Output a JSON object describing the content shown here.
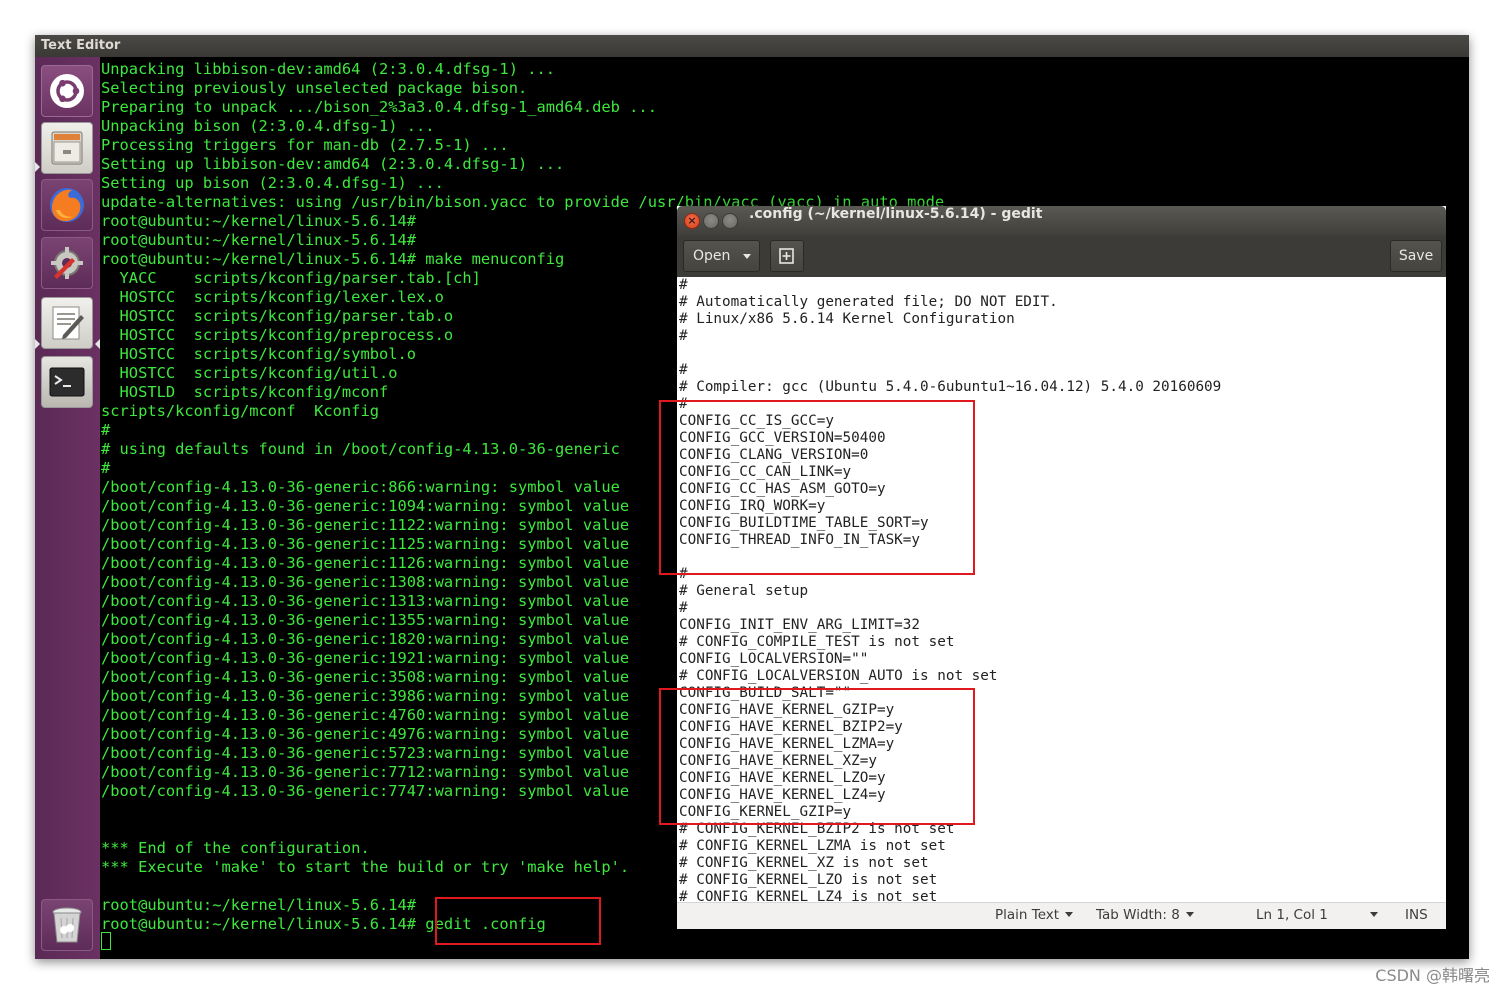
{
  "topbar": {
    "title": "Text Editor"
  },
  "launcher": {
    "items": [
      {
        "name": "ubuntu-dash"
      },
      {
        "name": "files"
      },
      {
        "name": "firefox"
      },
      {
        "name": "system-settings"
      },
      {
        "name": "text-editor"
      },
      {
        "name": "terminal"
      },
      {
        "name": "trash"
      }
    ]
  },
  "terminal": {
    "lines": [
      "Unpacking libbison-dev:amd64 (2:3.0.4.dfsg-1) ...",
      "Selecting previously unselected package bison.",
      "Preparing to unpack .../bison_2%3a3.0.4.dfsg-1_amd64.deb ...",
      "Unpacking bison (2:3.0.4.dfsg-1) ...",
      "Processing triggers for man-db (2.7.5-1) ...",
      "Setting up libbison-dev:amd64 (2:3.0.4.dfsg-1) ...",
      "Setting up bison (2:3.0.4.dfsg-1) ...",
      "update-alternatives: using /usr/bin/bison.yacc to provide /usr/bin/yacc (yacc) in auto mode",
      "root@ubuntu:~/kernel/linux-5.6.14#",
      "root@ubuntu:~/kernel/linux-5.6.14#",
      "root@ubuntu:~/kernel/linux-5.6.14# make menuconfig",
      "  YACC    scripts/kconfig/parser.tab.[ch]",
      "  HOSTCC  scripts/kconfig/lexer.lex.o",
      "  HOSTCC  scripts/kconfig/parser.tab.o",
      "  HOSTCC  scripts/kconfig/preprocess.o",
      "  HOSTCC  scripts/kconfig/symbol.o",
      "  HOSTCC  scripts/kconfig/util.o",
      "  HOSTLD  scripts/kconfig/mconf",
      "scripts/kconfig/mconf  Kconfig",
      "#",
      "# using defaults found in /boot/config-4.13.0-36-generic",
      "#",
      "/boot/config-4.13.0-36-generic:866:warning: symbol value",
      "/boot/config-4.13.0-36-generic:1094:warning: symbol value",
      "/boot/config-4.13.0-36-generic:1122:warning: symbol value",
      "/boot/config-4.13.0-36-generic:1125:warning: symbol value",
      "/boot/config-4.13.0-36-generic:1126:warning: symbol value",
      "/boot/config-4.13.0-36-generic:1308:warning: symbol value",
      "/boot/config-4.13.0-36-generic:1313:warning: symbol value",
      "/boot/config-4.13.0-36-generic:1355:warning: symbol value",
      "/boot/config-4.13.0-36-generic:1820:warning: symbol value",
      "/boot/config-4.13.0-36-generic:1921:warning: symbol value",
      "/boot/config-4.13.0-36-generic:3508:warning: symbol value",
      "/boot/config-4.13.0-36-generic:3986:warning: symbol value",
      "/boot/config-4.13.0-36-generic:4760:warning: symbol value",
      "/boot/config-4.13.0-36-generic:4976:warning: symbol value",
      "/boot/config-4.13.0-36-generic:5723:warning: symbol value",
      "/boot/config-4.13.0-36-generic:7712:warning: symbol value",
      "/boot/config-4.13.0-36-generic:7747:warning: symbol value",
      "",
      "",
      "*** End of the configuration.",
      "*** Execute 'make' to start the build or try 'make help'.",
      "",
      "root@ubuntu:~/kernel/linux-5.6.14#",
      "root@ubuntu:~/kernel/linux-5.6.14# gedit .config"
    ]
  },
  "gedit": {
    "title": ".config (~/kernel/linux-5.6.14) - gedit",
    "open_label": "Open",
    "save_label": "Save",
    "lines": [
      "#",
      "# Automatically generated file; DO NOT EDIT.",
      "# Linux/x86 5.6.14 Kernel Configuration",
      "#",
      "",
      "#",
      "# Compiler: gcc (Ubuntu 5.4.0-6ubuntu1~16.04.12) 5.4.0 20160609",
      "#",
      "CONFIG_CC_IS_GCC=y",
      "CONFIG_GCC_VERSION=50400",
      "CONFIG_CLANG_VERSION=0",
      "CONFIG_CC_CAN_LINK=y",
      "CONFIG_CC_HAS_ASM_GOTO=y",
      "CONFIG_IRQ_WORK=y",
      "CONFIG_BUILDTIME_TABLE_SORT=y",
      "CONFIG_THREAD_INFO_IN_TASK=y",
      "",
      "#",
      "# General setup",
      "#",
      "CONFIG_INIT_ENV_ARG_LIMIT=32",
      "# CONFIG_COMPILE_TEST is not set",
      "CONFIG_LOCALVERSION=\"\"",
      "# CONFIG_LOCALVERSION_AUTO is not set",
      "CONFIG_BUILD_SALT=\"\"",
      "CONFIG_HAVE_KERNEL_GZIP=y",
      "CONFIG_HAVE_KERNEL_BZIP2=y",
      "CONFIG_HAVE_KERNEL_LZMA=y",
      "CONFIG_HAVE_KERNEL_XZ=y",
      "CONFIG_HAVE_KERNEL_LZO=y",
      "CONFIG_HAVE_KERNEL_LZ4=y",
      "CONFIG_KERNEL_GZIP=y",
      "# CONFIG_KERNEL_BZIP2 is not set",
      "# CONFIG_KERNEL_LZMA is not set",
      "# CONFIG_KERNEL_XZ is not set",
      "# CONFIG_KERNEL_LZO is not set",
      "# CONFIG_KERNEL_LZ4 is not set"
    ],
    "status": {
      "language": "Plain Text",
      "tab_width": "Tab Width: 8",
      "position": "Ln 1, Col 1",
      "mode": "INS"
    }
  },
  "watermark": "CSDN @韩曙亮",
  "colors": {
    "terminal_text": "#3ee83e",
    "highlight": "#e0191e",
    "launcher": "#5e2c58"
  }
}
